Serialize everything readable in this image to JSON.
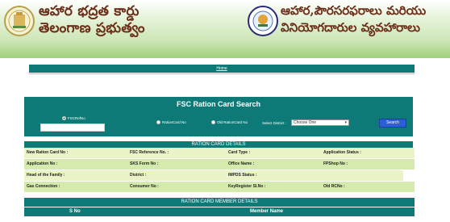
{
  "header": {
    "left_line1": "ఆహార భద్రత కార్డు",
    "left_line2": "తెలంగాణ ప్రభుత్వం",
    "right_line1": "ఆహార,పౌరసరఫరాలు మరియు",
    "right_line2": "వినియోగదారుల వ్యవహారాలు",
    "left_emblem_icon": "telangana-emblem-icon",
    "right_emblem_icon": "civil-supplies-emblem-icon"
  },
  "top_bar": {
    "link_text": "Home"
  },
  "search": {
    "title": "FSC Ration Card Search",
    "options": [
      "FSCRefNo",
      "RationCard No",
      "Old RationCard No"
    ],
    "fsc_input_value": "",
    "district_label": "Select District :",
    "district_selected": "Choose One",
    "search_button": "Search"
  },
  "details": {
    "title": "RATION CARD DETAILS",
    "rows": [
      [
        "New Ration Card No :",
        "FSC Reference No. :",
        "Card Type :",
        "Application Status :"
      ],
      [
        "Application No :",
        "SKS Form No :",
        "Office Name :",
        "FPShop No :"
      ],
      [
        "Head of the Family :",
        "District :",
        "IMPDS Status :",
        ""
      ],
      [
        "Gas Connection :",
        "Consumer No :",
        "KeyRegister Sl.No :",
        "Old RCNo :"
      ]
    ]
  },
  "members": {
    "title": "RATION CARD MEMBER DETAILS",
    "columns": [
      "S No",
      "Member Name"
    ]
  },
  "colors": {
    "teal": "#0e7a78",
    "row_light": "#e9f4c8",
    "row_dark": "#d5ebad",
    "header_text": "#6b2f1a",
    "button_blue": "#2a5fd6"
  }
}
